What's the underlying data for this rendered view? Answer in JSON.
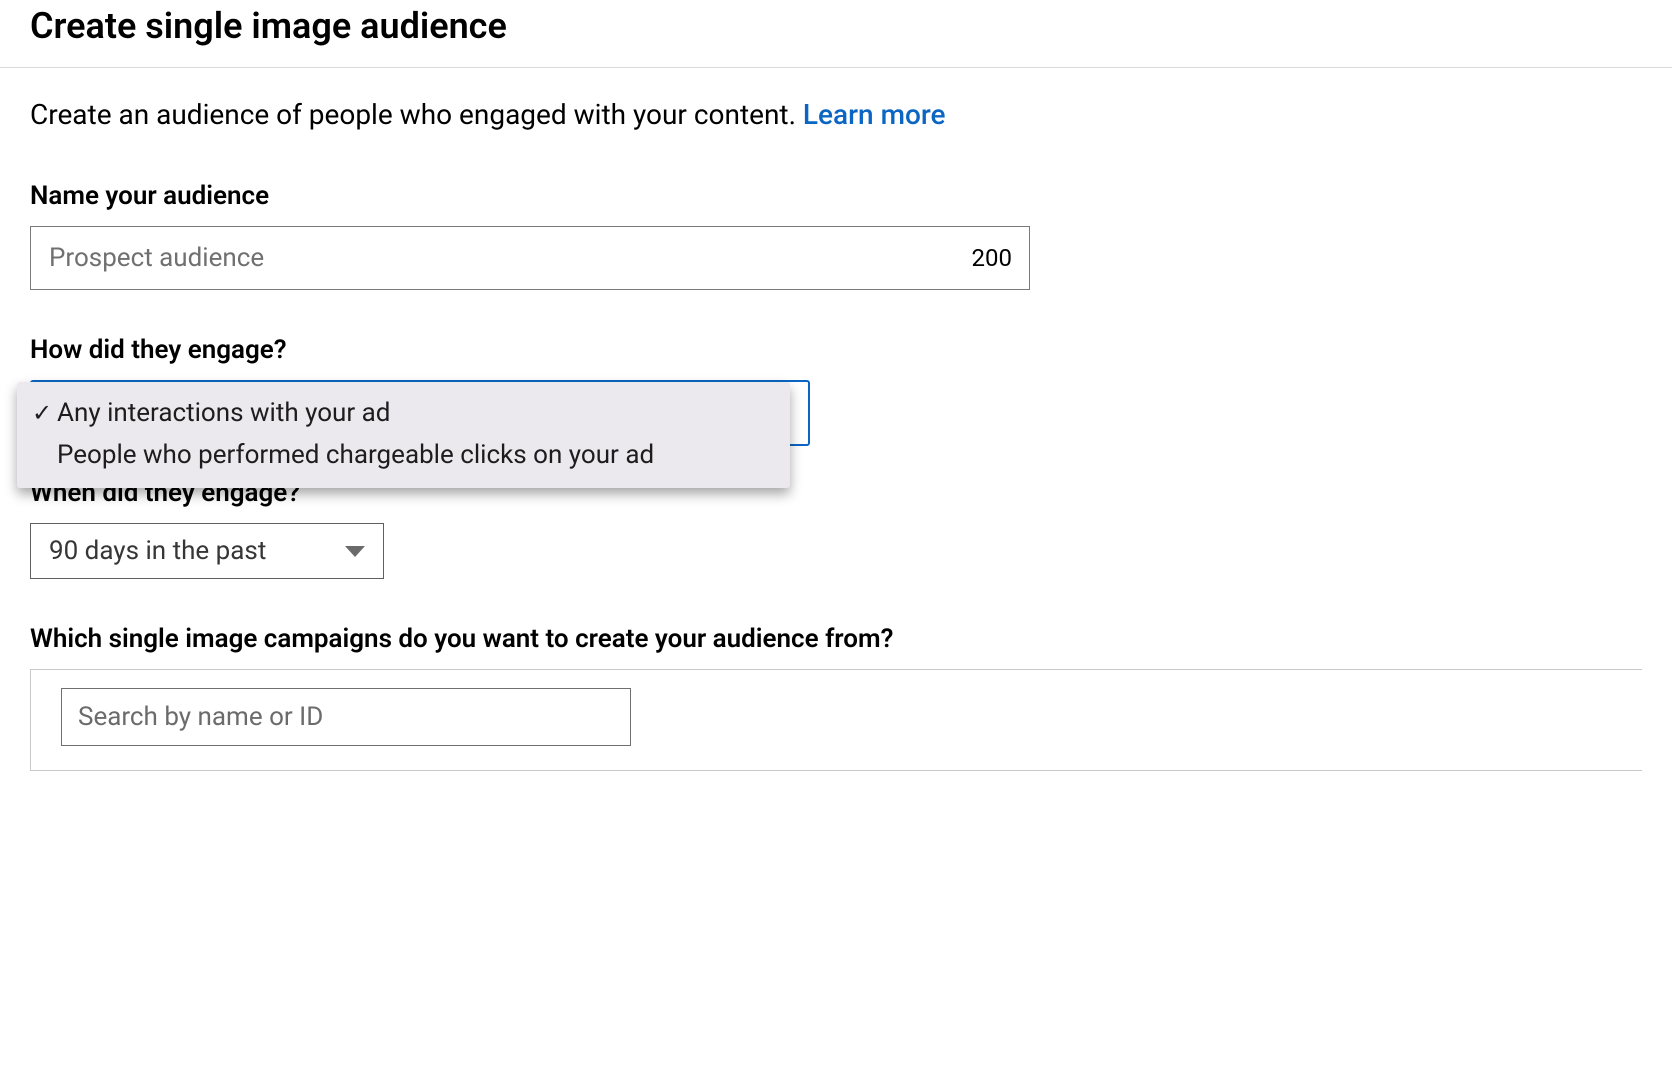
{
  "header": {
    "title": "Create single image audience"
  },
  "description": {
    "text": "Create an audience of people who engaged with your content. ",
    "learn_more": "Learn more"
  },
  "name_field": {
    "label": "Name your audience",
    "placeholder": "Prospect audience",
    "value": "",
    "counter": "200"
  },
  "engage_field": {
    "label": "How did they engage?",
    "options": [
      {
        "label": "Any interactions with your ad",
        "selected": true
      },
      {
        "label": "People who performed chargeable clicks on your ad",
        "selected": false
      }
    ]
  },
  "when_field": {
    "label": "When did they engage?",
    "selected": "90 days in the past"
  },
  "campaigns_field": {
    "label": "Which single image campaigns do you want to create your audience from?",
    "search_placeholder": "Search by name or ID"
  }
}
